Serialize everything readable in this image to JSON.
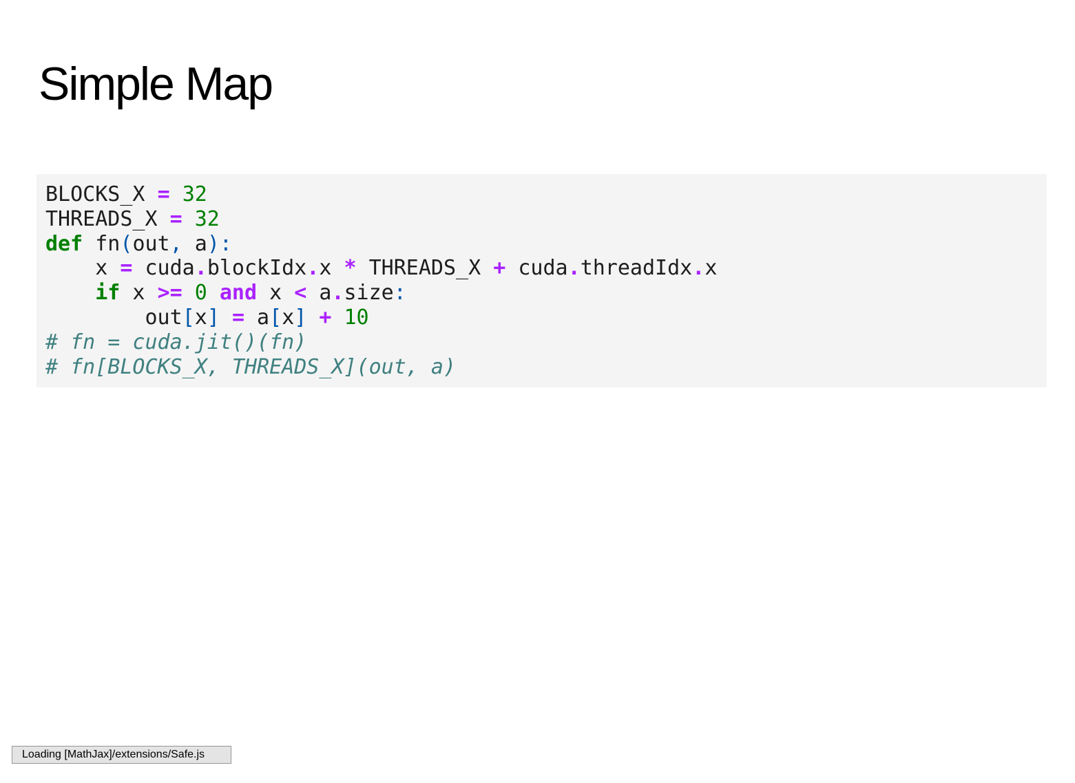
{
  "slide": {
    "title": "Simple Map"
  },
  "code": {
    "lines": [
      [
        {
          "cls": "",
          "text": "BLOCKS_X "
        },
        {
          "cls": "op",
          "text": "="
        },
        {
          "cls": "",
          "text": " "
        },
        {
          "cls": "num",
          "text": "32"
        }
      ],
      [
        {
          "cls": "",
          "text": "THREADS_X "
        },
        {
          "cls": "op",
          "text": "="
        },
        {
          "cls": "",
          "text": " "
        },
        {
          "cls": "num",
          "text": "32"
        }
      ],
      [
        {
          "cls": "kw",
          "text": "def"
        },
        {
          "cls": "",
          "text": " fn"
        },
        {
          "cls": "punc",
          "text": "("
        },
        {
          "cls": "",
          "text": "out"
        },
        {
          "cls": "punc",
          "text": ","
        },
        {
          "cls": "",
          "text": " a"
        },
        {
          "cls": "punc",
          "text": "):"
        }
      ],
      [
        {
          "cls": "",
          "text": "    x "
        },
        {
          "cls": "op",
          "text": "="
        },
        {
          "cls": "",
          "text": " cuda"
        },
        {
          "cls": "op",
          "text": "."
        },
        {
          "cls": "",
          "text": "blockIdx"
        },
        {
          "cls": "op",
          "text": "."
        },
        {
          "cls": "",
          "text": "x "
        },
        {
          "cls": "op",
          "text": "*"
        },
        {
          "cls": "",
          "text": " THREADS_X "
        },
        {
          "cls": "op",
          "text": "+"
        },
        {
          "cls": "",
          "text": " cuda"
        },
        {
          "cls": "op",
          "text": "."
        },
        {
          "cls": "",
          "text": "threadIdx"
        },
        {
          "cls": "op",
          "text": "."
        },
        {
          "cls": "",
          "text": "x"
        }
      ],
      [
        {
          "cls": "",
          "text": "    "
        },
        {
          "cls": "kw",
          "text": "if"
        },
        {
          "cls": "",
          "text": " x "
        },
        {
          "cls": "op",
          "text": ">="
        },
        {
          "cls": "",
          "text": " "
        },
        {
          "cls": "num",
          "text": "0"
        },
        {
          "cls": "",
          "text": " "
        },
        {
          "cls": "op",
          "text": "and"
        },
        {
          "cls": "",
          "text": " x "
        },
        {
          "cls": "op",
          "text": "<"
        },
        {
          "cls": "",
          "text": " a"
        },
        {
          "cls": "op",
          "text": "."
        },
        {
          "cls": "",
          "text": "size"
        },
        {
          "cls": "punc",
          "text": ":"
        }
      ],
      [
        {
          "cls": "",
          "text": "        out"
        },
        {
          "cls": "punc",
          "text": "["
        },
        {
          "cls": "",
          "text": "x"
        },
        {
          "cls": "punc",
          "text": "]"
        },
        {
          "cls": "",
          "text": " "
        },
        {
          "cls": "op",
          "text": "="
        },
        {
          "cls": "",
          "text": " a"
        },
        {
          "cls": "punc",
          "text": "["
        },
        {
          "cls": "",
          "text": "x"
        },
        {
          "cls": "punc",
          "text": "]"
        },
        {
          "cls": "",
          "text": " "
        },
        {
          "cls": "op",
          "text": "+"
        },
        {
          "cls": "",
          "text": " "
        },
        {
          "cls": "num",
          "text": "10"
        }
      ],
      [
        {
          "cls": "cm",
          "text": "# fn = cuda.jit()(fn)"
        }
      ],
      [
        {
          "cls": "cm",
          "text": "# fn[BLOCKS_X, THREADS_X](out, a)"
        }
      ]
    ]
  },
  "status": {
    "text": "Loading [MathJax]/extensions/Safe.js"
  }
}
